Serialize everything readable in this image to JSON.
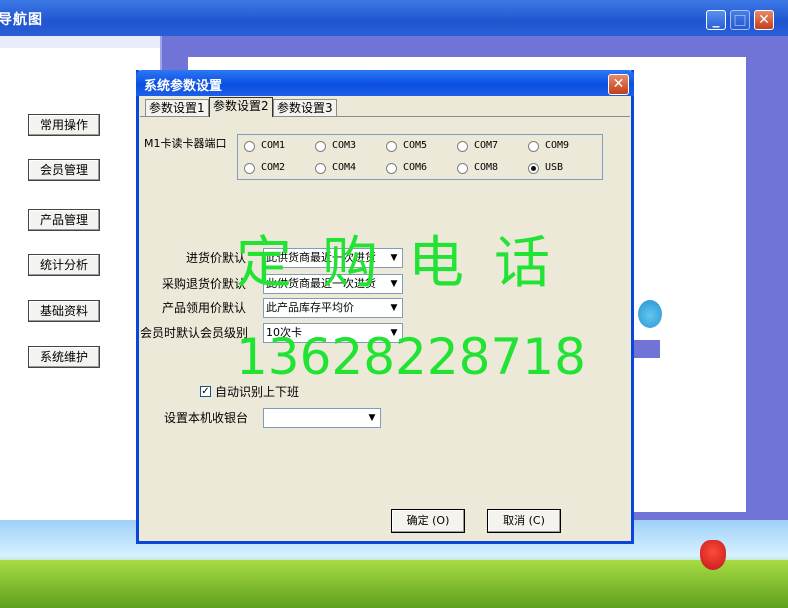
{
  "main_window": {
    "title": "导航图"
  },
  "nav": {
    "items": [
      {
        "label": "常用操作"
      },
      {
        "label": "会员管理"
      },
      {
        "label": "产品管理"
      },
      {
        "label": "统计分析"
      },
      {
        "label": "基础资料"
      },
      {
        "label": "系统维护"
      }
    ]
  },
  "dialog": {
    "title": "系统参数设置",
    "close_label": "✕",
    "tabs": [
      {
        "label": "参数设置1"
      },
      {
        "label": "参数设置2"
      },
      {
        "label": "参数设置3"
      }
    ],
    "active_tab": "参数设置2",
    "port": {
      "label": "M1卡读卡器端口",
      "options": [
        "COM1",
        "COM3",
        "COM5",
        "COM7",
        "COM9",
        "COM2",
        "COM4",
        "COM6",
        "COM8",
        "USB"
      ],
      "selected": "USB"
    },
    "fields": [
      {
        "label": "进货价默认",
        "value": "此供货商最近一次进货"
      },
      {
        "label": "采购退货价默认",
        "value": "此供货商最近一次进货"
      },
      {
        "label": "产品领用价默认",
        "value": "此产品库存平均价"
      },
      {
        "label": "会员时默认会员级别",
        "value": "10次卡"
      }
    ],
    "auto_shift": {
      "label": "自动识别上下班",
      "checked": true
    },
    "cashier": {
      "label": "设置本机收银台",
      "value": ""
    },
    "ok_label": "确定 (O)",
    "cancel_label": "取消 (C)"
  },
  "watermark": {
    "line1": "定购电话",
    "line2": "13628228718",
    "color": "#22e234"
  }
}
